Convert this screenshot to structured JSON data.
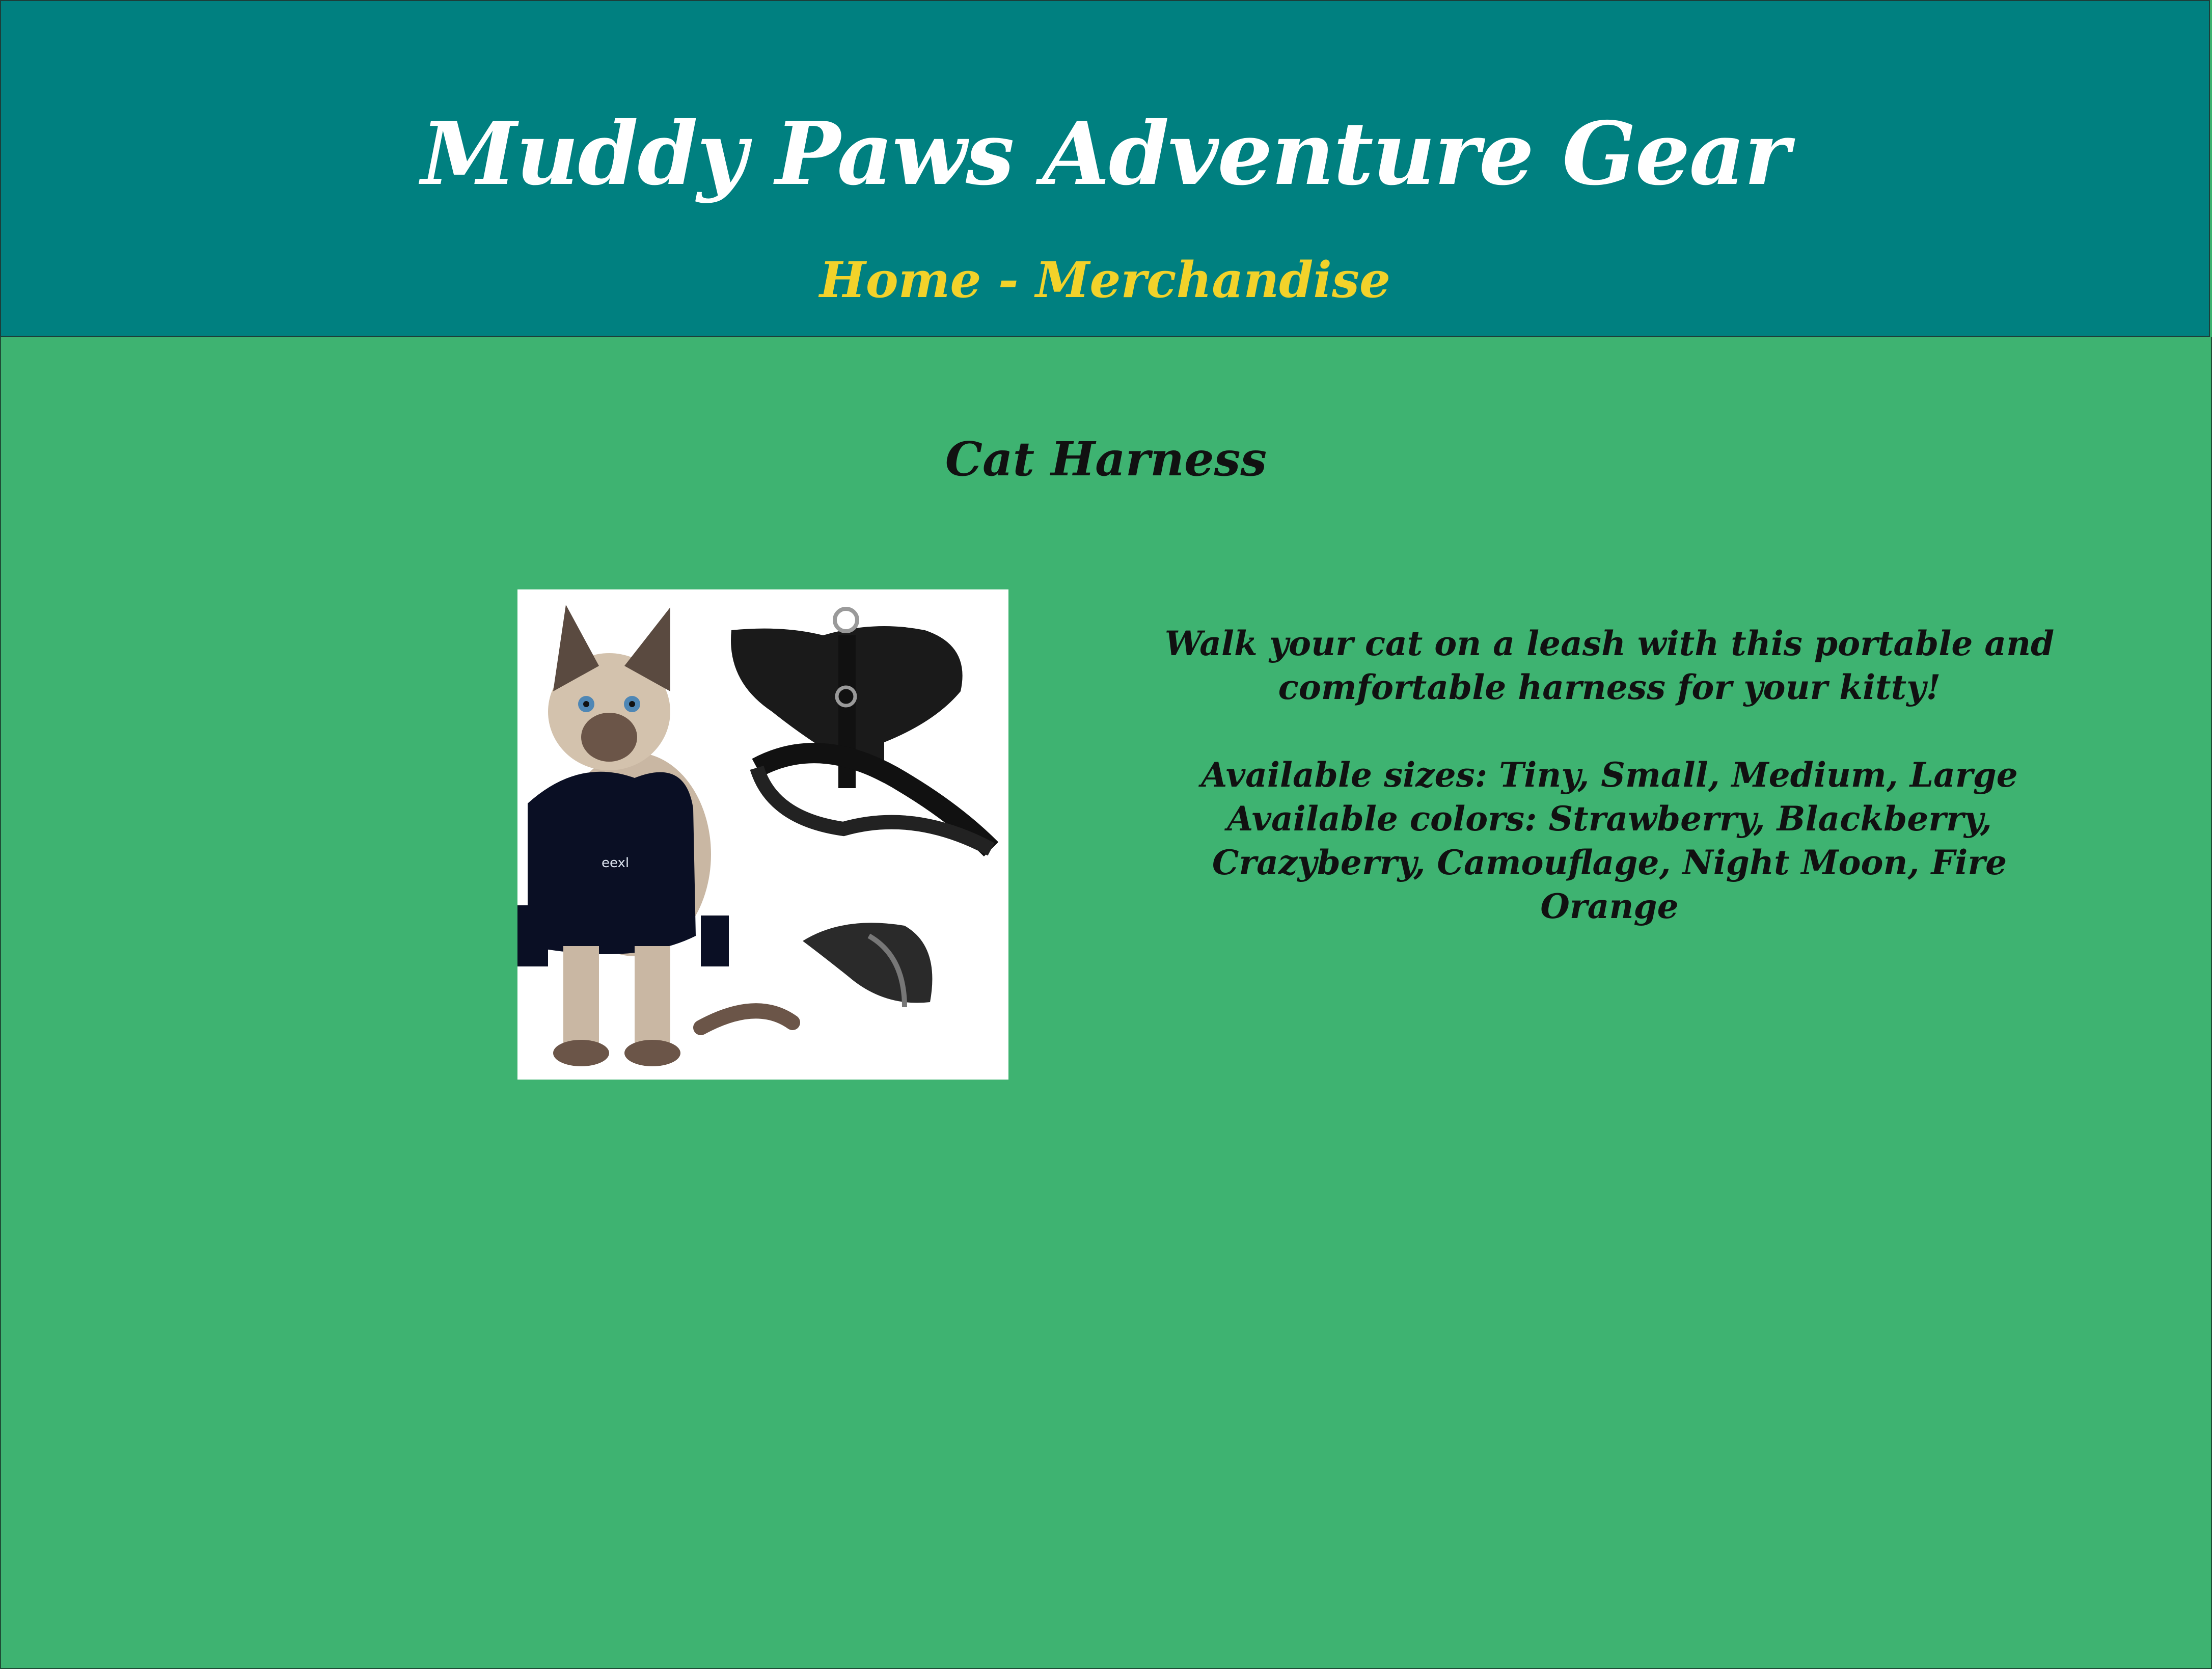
{
  "header": {
    "site_title": "Muddy Paws Adventure Gear",
    "nav": {
      "home": "Home",
      "separator": " - ",
      "merchandise": "Merchandise"
    }
  },
  "product": {
    "title": "Cat Harness",
    "image_alt": "cat-harness-photo",
    "description_line1": "Walk your cat on a leash with this portable and comfortable harness for your kitty!",
    "sizes": "Available sizes: Tiny, Small, Medium, Large",
    "colors": "Available colors: Strawberry, Blackberry, Crazyberry, Camouflage, Night Moon, Fire Orange"
  },
  "colors": {
    "header_bg": "#008080",
    "page_bg": "#3eb371",
    "nav_text": "#f2d22a",
    "title_text": "#ffffff"
  }
}
